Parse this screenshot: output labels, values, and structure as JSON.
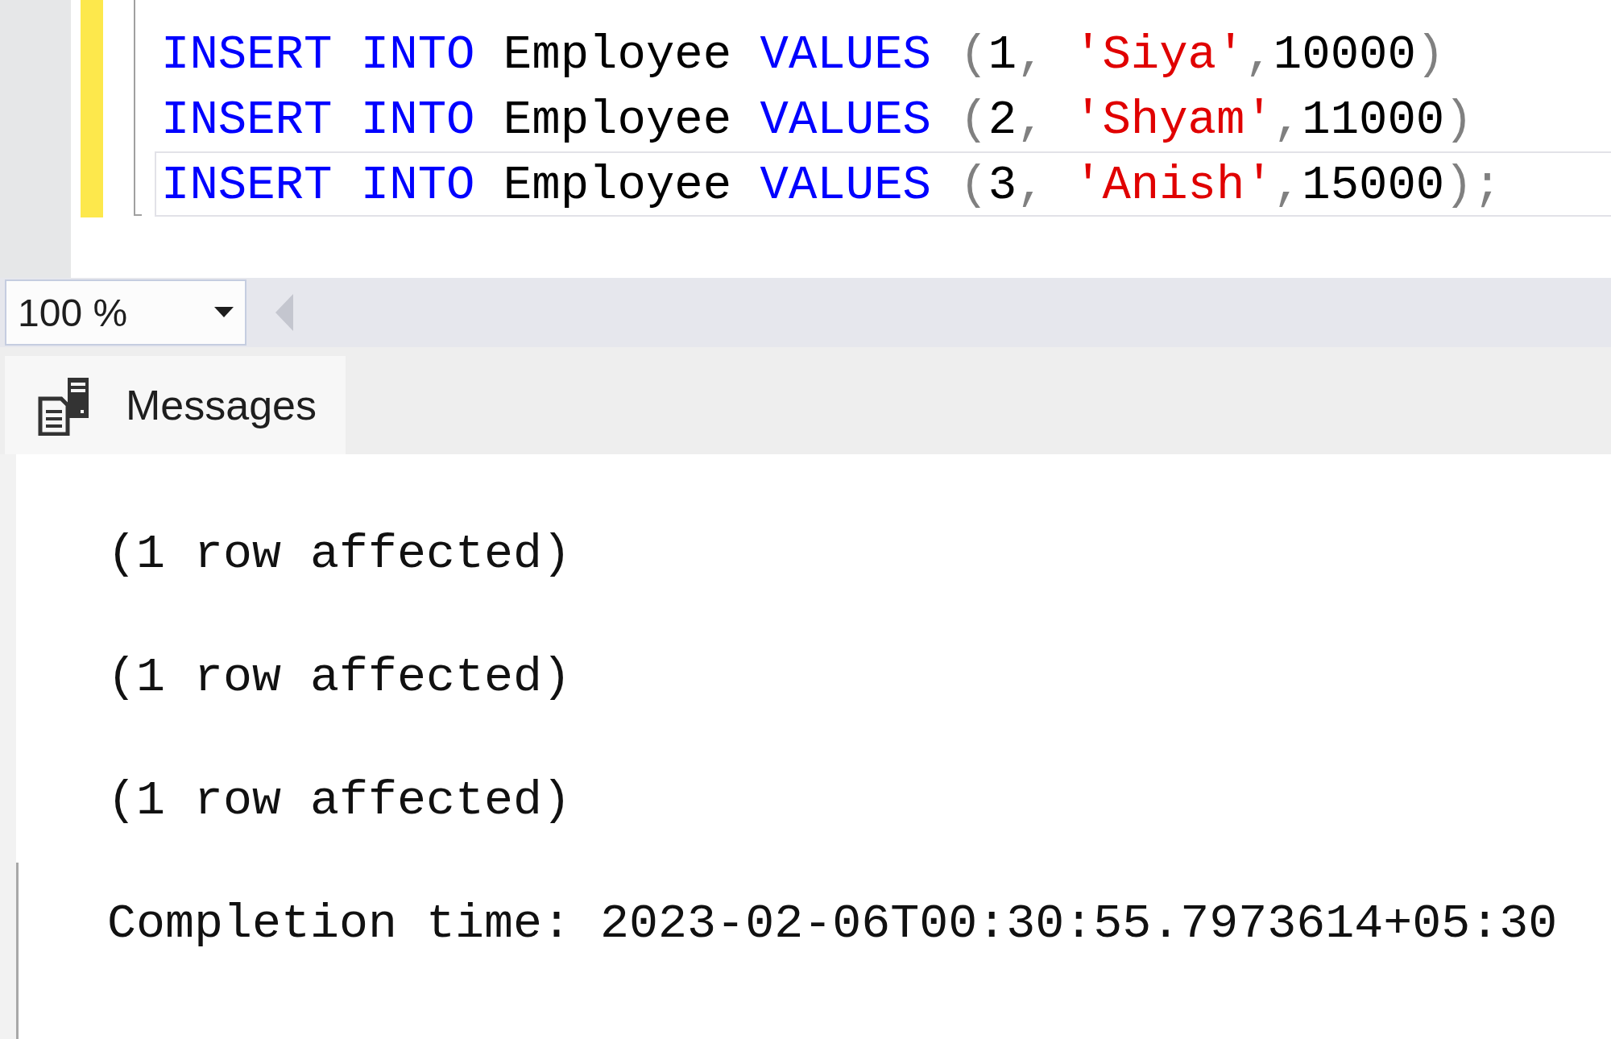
{
  "editor": {
    "lines": [
      {
        "current": false,
        "tokens": [
          {
            "kind": "keyword",
            "text": "INSERT INTO"
          },
          {
            "kind": "plain",
            "text": " Employee "
          },
          {
            "kind": "keyword",
            "text": "VALUES"
          },
          {
            "kind": "punct",
            "text": " ("
          },
          {
            "kind": "plain",
            "text": "1"
          },
          {
            "kind": "punct",
            "text": ", "
          },
          {
            "kind": "string",
            "text": "'Siya'"
          },
          {
            "kind": "punct",
            "text": ","
          },
          {
            "kind": "plain",
            "text": "10000"
          },
          {
            "kind": "punct",
            "text": ")"
          }
        ]
      },
      {
        "current": false,
        "tokens": [
          {
            "kind": "keyword",
            "text": "INSERT INTO"
          },
          {
            "kind": "plain",
            "text": " Employee "
          },
          {
            "kind": "keyword",
            "text": "VALUES"
          },
          {
            "kind": "punct",
            "text": " ("
          },
          {
            "kind": "plain",
            "text": "2"
          },
          {
            "kind": "punct",
            "text": ", "
          },
          {
            "kind": "string",
            "text": "'Shyam'"
          },
          {
            "kind": "punct",
            "text": ","
          },
          {
            "kind": "plain",
            "text": "11000"
          },
          {
            "kind": "punct",
            "text": ")"
          }
        ]
      },
      {
        "current": true,
        "tokens": [
          {
            "kind": "keyword",
            "text": "INSERT INTO"
          },
          {
            "kind": "plain",
            "text": " Employee "
          },
          {
            "kind": "keyword",
            "text": "VALUES"
          },
          {
            "kind": "punct",
            "text": " ("
          },
          {
            "kind": "plain",
            "text": "3"
          },
          {
            "kind": "punct",
            "text": ", "
          },
          {
            "kind": "string",
            "text": "'Anish'"
          },
          {
            "kind": "punct",
            "text": ","
          },
          {
            "kind": "plain",
            "text": "15000"
          },
          {
            "kind": "punct",
            "text": ");"
          }
        ]
      }
    ]
  },
  "zoom": {
    "value": "100 %"
  },
  "tabs": [
    {
      "label": "Messages",
      "selected": true
    }
  ],
  "messages": [
    "(1 row affected)",
    "(1 row affected)",
    "(1 row affected)",
    "Completion time: 2023-02-06T00:30:55.7973614+05:30"
  ]
}
